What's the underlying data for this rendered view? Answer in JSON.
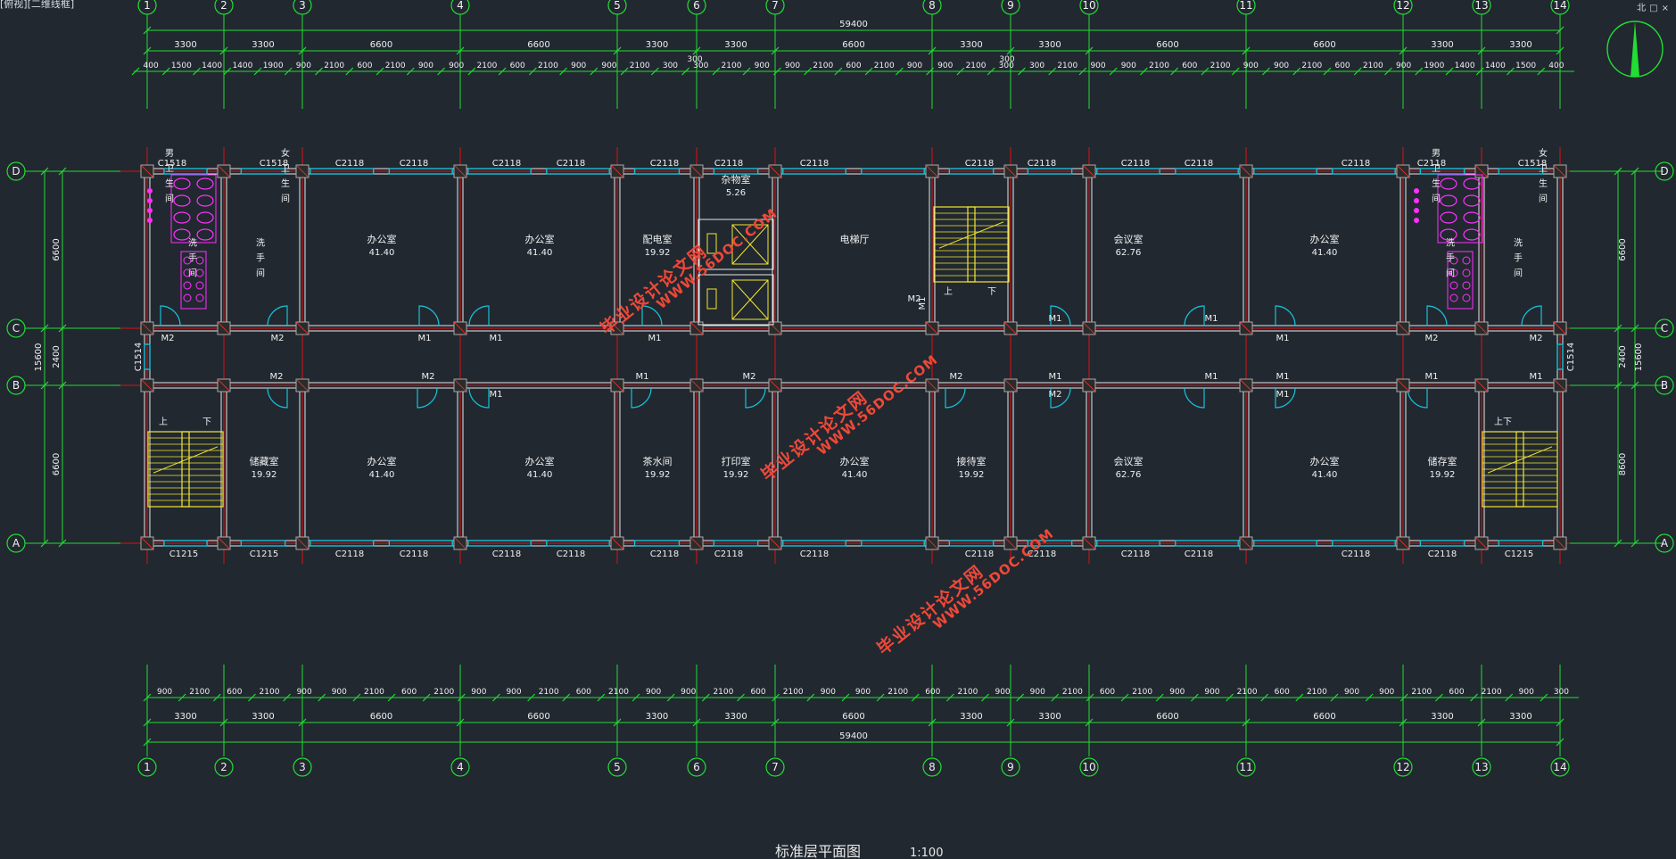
{
  "viewport_label": "[俯视][二维线框]",
  "view_controls": [
    "北",
    "□",
    "×"
  ],
  "title": "标准层平面图",
  "scale": "1:100",
  "colors": {
    "background": "#212830",
    "dimension": "#22dd33",
    "grid_line": "#e01010",
    "wall": "#e8e8e8",
    "window": "#18c0d8",
    "door": "#18c0d8",
    "column": "#a9a9a9",
    "stair": "#f2e630",
    "fixture": "#ff30ff",
    "room_text": "#f0f0f0",
    "watermark": "#f04838"
  },
  "axes_x": [
    "1",
    "2",
    "3",
    "4",
    "5",
    "6",
    "7",
    "8",
    "9",
    "10",
    "11",
    "12",
    "13",
    "14"
  ],
  "axes_y": [
    "D",
    "C",
    "B",
    "A"
  ],
  "top_dimensions": {
    "total": "59400",
    "bays": [
      "3300",
      "3300",
      "6600",
      "6600",
      "3300",
      "3300",
      "6600",
      "3300",
      "3300",
      "6600",
      "6600",
      "3300",
      "3300"
    ],
    "details": [
      "400",
      "1500",
      "1400",
      "1400",
      "1900",
      "900",
      "2100",
      "600",
      "2100",
      "900",
      "900",
      "2100",
      "600",
      "2100",
      "900",
      "900",
      "2100",
      "300",
      "300",
      "2100",
      "900",
      "900",
      "2100",
      "600",
      "2100",
      "900",
      "900",
      "2100",
      "300",
      "300",
      "2100",
      "900",
      "900",
      "2100",
      "600",
      "2100",
      "900",
      "900",
      "2100",
      "600",
      "2100",
      "900",
      "1900",
      "1400",
      "1400",
      "1500",
      "400"
    ],
    "extra": [
      "300",
      "300"
    ]
  },
  "bottom_dimensions": {
    "total": "59400",
    "bays": [
      "3300",
      "3300",
      "6600",
      "6600",
      "3300",
      "3300",
      "6600",
      "3300",
      "3300",
      "6600",
      "6600",
      "3300",
      "3300"
    ],
    "details": [
      "900",
      "2100",
      "600",
      "2100",
      "900",
      "900",
      "2100",
      "600",
      "2100",
      "900",
      "900",
      "2100",
      "600",
      "2100",
      "900",
      "900",
      "2100",
      "600",
      "2100",
      "900",
      "900",
      "2100",
      "600",
      "2100",
      "900",
      "900",
      "2100",
      "600",
      "2100",
      "900",
      "900",
      "2100",
      "600",
      "2100",
      "900",
      "900",
      "2100",
      "600",
      "2100",
      "900",
      "300"
    ]
  },
  "left_dimensions": {
    "total": "15600",
    "spans": [
      "6600",
      "2400",
      "6600"
    ]
  },
  "right_dimensions": {
    "total": "15600",
    "spans": [
      "6600",
      "2400",
      "8600"
    ]
  },
  "window_labels_top": [
    "C1518",
    "C1518",
    "C2118",
    "C2118",
    "C2118",
    "C2118",
    "C2118",
    "C2118",
    "C2118",
    "C2118",
    "C2118",
    "C2118",
    "C2118",
    "C2118",
    "C2118",
    "C1518",
    "C1518"
  ],
  "window_labels_bottom": [
    "C1215",
    "C1215",
    "C2118",
    "C2118",
    "C2118",
    "C2118",
    "C2118",
    "C2118",
    "C2118",
    "C2118",
    "C2118",
    "C2118",
    "C2118",
    "C2118",
    "C2118",
    "C1215",
    "C1215"
  ],
  "window_side_labels": [
    "C1514",
    "C1514"
  ],
  "door_labels": [
    "M2",
    "M2",
    "M1",
    "M1",
    "M1",
    "M1",
    "M1",
    "M1",
    "M2",
    "M2",
    "M2",
    "M2",
    "M1",
    "M1",
    "M2",
    "M2",
    "M1",
    "M1",
    "M1",
    "M1",
    "M2",
    "M1",
    "M2",
    "M1"
  ],
  "rooms_north": [
    {
      "name": "男卫生间",
      "vertical": true
    },
    {
      "name": "女卫生间",
      "vertical": true
    },
    {
      "name": "洗手间",
      "vertical": true
    },
    {
      "name": "洗手间",
      "vertical": true
    },
    {
      "name": "办公室",
      "area": "41.40"
    },
    {
      "name": "办公室",
      "area": "41.40"
    },
    {
      "name": "配电室",
      "area": "19.92"
    },
    {
      "name": "杂物室",
      "area": "5.26"
    },
    {
      "name": "电梯厅",
      "area": ""
    },
    {
      "name": "会议室",
      "area": "62.76"
    },
    {
      "name": "办公室",
      "area": "41.40"
    },
    {
      "name": "男卫生间",
      "vertical": true
    },
    {
      "name": "女卫生间",
      "vertical": true
    },
    {
      "name": "洗手间",
      "vertical": true
    },
    {
      "name": "洗手间",
      "vertical": true
    }
  ],
  "rooms_south": [
    {
      "name": "储藏室",
      "area": "19.92"
    },
    {
      "name": "办公室",
      "area": "41.40"
    },
    {
      "name": "办公室",
      "area": "41.40"
    },
    {
      "name": "茶水间",
      "area": "19.92"
    },
    {
      "name": "打印室",
      "area": "19.92"
    },
    {
      "name": "办公室",
      "area": "41.40"
    },
    {
      "name": "接待室",
      "area": "19.92"
    },
    {
      "name": "会议室",
      "area": "62.76"
    },
    {
      "name": "办公室",
      "area": "41.40"
    },
    {
      "name": "储存室",
      "area": "19.92"
    }
  ],
  "stair_labels": [
    "上",
    "下",
    "上",
    "下",
    "上",
    "下"
  ],
  "side_mark": "M1",
  "watermarks": [
    {
      "line1": "毕业设计论文网",
      "line2": "WWW.56DOC.COM"
    },
    {
      "line1": "毕业设计论文网",
      "line2": "WWW.56DOC.COM"
    },
    {
      "line1": "毕业设计论文网",
      "line2": "WWW.56DOC.COM"
    }
  ]
}
